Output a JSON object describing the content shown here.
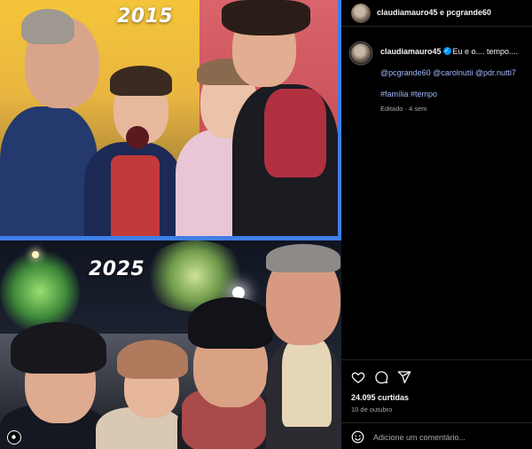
{
  "post": {
    "header_authors": "claudiamauro45 e pcgrande60",
    "author": "claudiamauro45",
    "caption_text": "Eu e o.... tempo....",
    "mentions": "@pcgrande60 @carolnutii @pdr.nutti7",
    "hashtags": "#família #tempo",
    "meta": "Editado · 4 sem",
    "likes": "24.095 curtidas",
    "date": "10 de outubro",
    "comment_placeholder": "Adicione um comentário..."
  },
  "media": {
    "year_top": "2015",
    "year_bottom": "2025"
  },
  "icons": {
    "like": "heart-icon",
    "comment": "comment-icon",
    "share": "share-icon",
    "emoji": "emoji-icon",
    "carousel": "carousel-icon",
    "verified": "verified-badge-icon"
  },
  "colors": {
    "accent_link": "#a1b9ff",
    "verified": "#0095f6",
    "frame": "#3f7fe6"
  }
}
